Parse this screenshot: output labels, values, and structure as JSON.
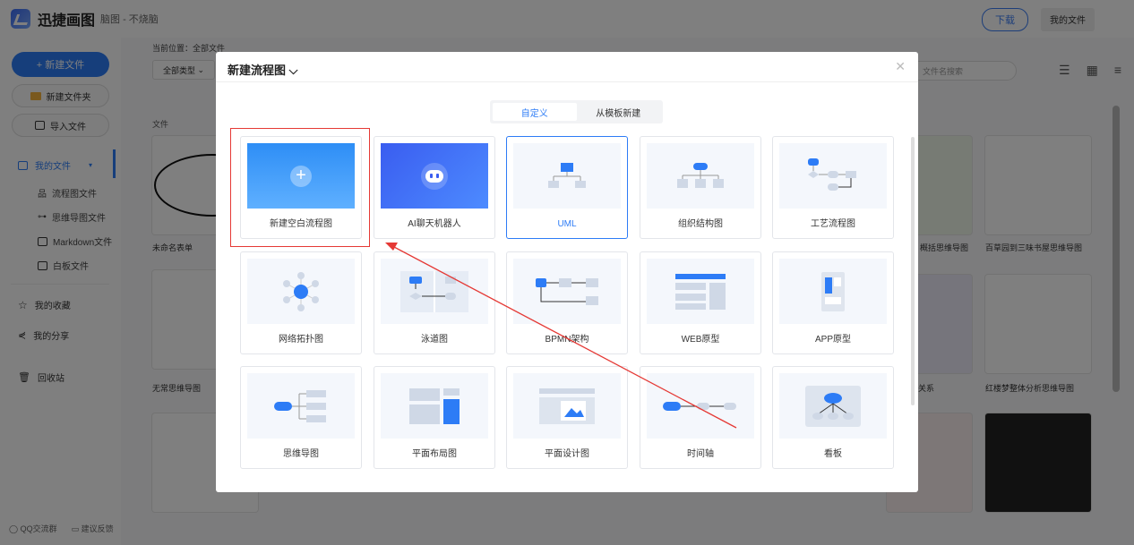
{
  "app": {
    "name": "迅捷画图",
    "subtitle": "脑图 - 不烧脑"
  },
  "topbar": {
    "download": "下载",
    "my_files": "我的文件"
  },
  "sidebar": {
    "new_file": "+ 新建文件",
    "new_folder": "新建文件夹",
    "import": "导入文件",
    "my_files": "我的文件",
    "flowchart_files": "流程图文件",
    "mindmap_files": "思维导图文件",
    "markdown_files": "Markdown文件",
    "whiteboard_files": "白板文件",
    "favorites": "我的收藏",
    "shares": "我的分享",
    "trash": "回收站",
    "qq_group": "QQ交流群",
    "feedback": "建议反馈"
  },
  "main": {
    "breadcrumb": "当前位置：全部文件",
    "filter": "全部类型",
    "search_placeholder": "文件名搜索",
    "section_label": "文件",
    "cards": [
      {
        "title": "未命名表单"
      },
      {
        "title": "无常思维导图"
      },
      {
        "title": "概括思维导图"
      },
      {
        "title": "百草园到三味书屋思维导图"
      },
      {
        "title": "关系"
      },
      {
        "title": "红楼梦整体分析思维导图"
      }
    ]
  },
  "modal": {
    "title": "新建流程图",
    "tabs": [
      {
        "label": "自定义"
      },
      {
        "label": "从模板新建"
      }
    ],
    "tiles": [
      {
        "label": "新建空白流程图"
      },
      {
        "label": "AI聊天机器人"
      },
      {
        "label": "UML"
      },
      {
        "label": "组织结构图"
      },
      {
        "label": "工艺流程图"
      },
      {
        "label": "网络拓扑图"
      },
      {
        "label": "泳道图"
      },
      {
        "label": "BPMN架构"
      },
      {
        "label": "WEB原型"
      },
      {
        "label": "APP原型"
      },
      {
        "label": "思维导图"
      },
      {
        "label": "平面布局图"
      },
      {
        "label": "平面设计图"
      },
      {
        "label": "时间轴"
      },
      {
        "label": "看板"
      }
    ]
  },
  "colors": {
    "accent": "#2d7cf6",
    "annotation": "#e53935"
  }
}
